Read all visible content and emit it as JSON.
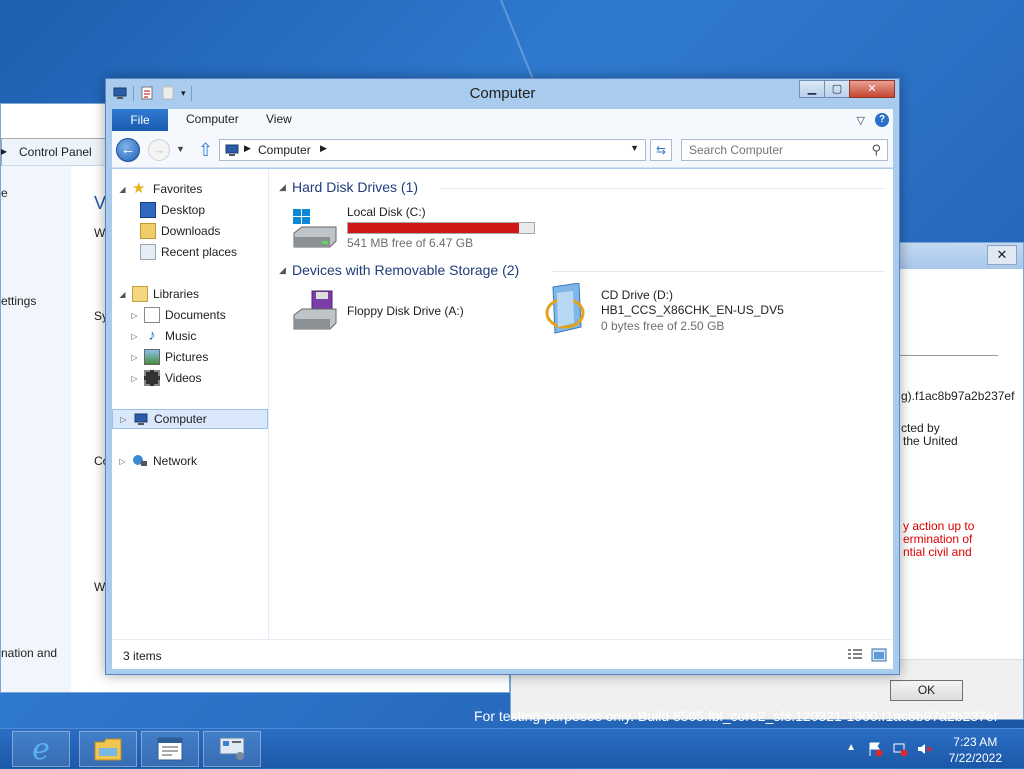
{
  "window": {
    "title": "Computer"
  },
  "ribbon": {
    "tabs": [
      "File",
      "Computer",
      "View"
    ]
  },
  "address": {
    "path": "Computer"
  },
  "search": {
    "placeholder": "Search Computer"
  },
  "nav_pane": {
    "favorites": {
      "label": "Favorites",
      "items": [
        "Desktop",
        "Downloads",
        "Recent places"
      ]
    },
    "libraries": {
      "label": "Libraries",
      "items": [
        "Documents",
        "Music",
        "Pictures",
        "Videos"
      ]
    },
    "computer": "Computer",
    "network": "Network"
  },
  "content": {
    "groups": [
      {
        "header": "Hard Disk Drives (1)",
        "drives": [
          {
            "name": "Local Disk (C:)",
            "free_text": "541 MB free of 6.47 GB",
            "used_fraction": 0.92,
            "bar_color": "#d01818"
          }
        ]
      },
      {
        "header": "Devices with Removable Storage (2)",
        "drives": [
          {
            "name": "Floppy Disk Drive (A:)"
          },
          {
            "name": "CD Drive (D:)",
            "label": "HB1_CCS_X86CHK_EN-US_DV5",
            "free_text": "0 bytes free of 2.50 GB"
          }
        ]
      }
    ]
  },
  "status": {
    "items_count": "3 items"
  },
  "background": {
    "control_panel_crumb": "Control Panel",
    "fragments": [
      "e",
      "Vi",
      "W",
      "ettings",
      "Sy",
      "Co",
      "W",
      "nation and"
    ],
    "dialog": {
      "lines": [
        "g).f1ac8b97a2b237ef",
        "cted by",
        "the United"
      ],
      "red_lines": [
        "y action up to",
        "ermination of",
        "ntial civil and"
      ],
      "ok_label": "OK"
    },
    "watermark": "For testing purposes only. Build 8505.fbl_core2_sfs.120321-1900.f1ac8b97a2b237ef"
  },
  "taskbar": {
    "time": "7:23 AM",
    "date": "7/22/2022"
  },
  "colors": {
    "accent": "#1a5bb0",
    "capacity_bar": "#d01818",
    "group_header": "#1e3d7a"
  }
}
